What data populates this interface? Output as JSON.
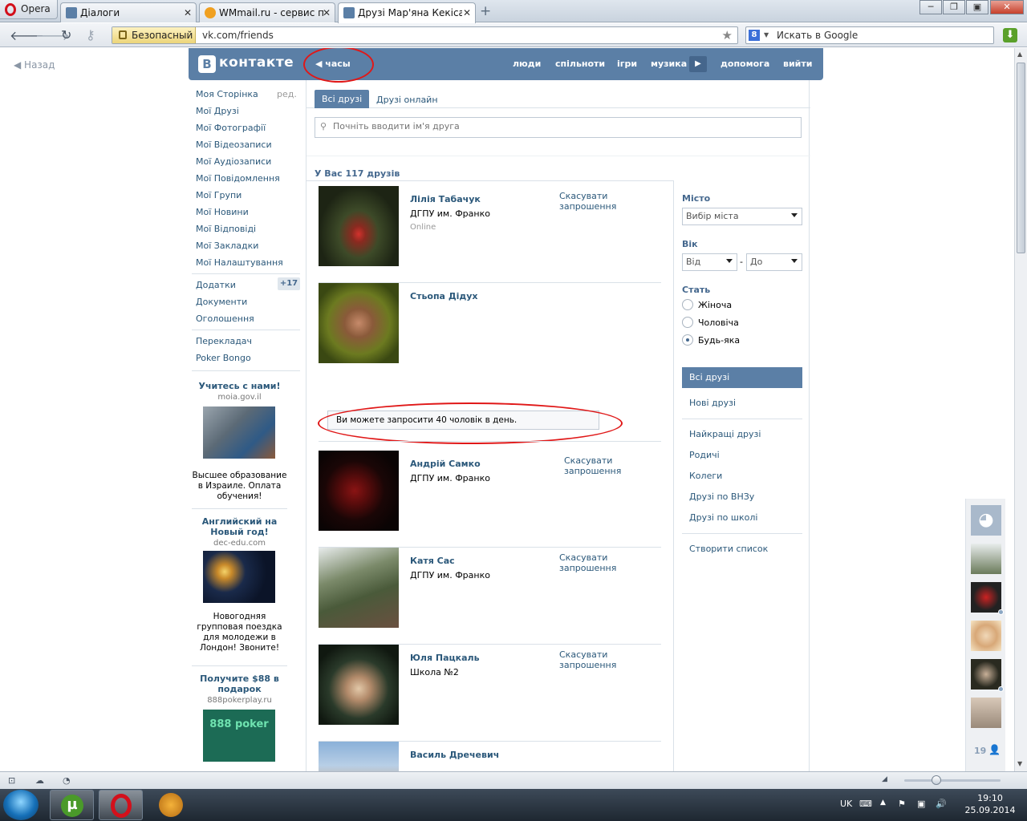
{
  "browser": {
    "opera_label": "Opera",
    "tabs": [
      {
        "title": "Діалоги",
        "active": false
      },
      {
        "title": "WMmail.ru - сервис п...",
        "active": false
      },
      {
        "title": "Друзі Мар'яна Кекіса |...",
        "active": true
      }
    ],
    "secure_label": "Безопасный",
    "url": "vk.com/friends",
    "search_placeholder": "Искать в Google",
    "search_engine_icon": "8"
  },
  "page": {
    "back_label": "Назад",
    "header": {
      "logo_letter": "В",
      "logo_text": "контакте",
      "back_link": "часы",
      "nav": [
        "люди",
        "спільноти",
        "ігри",
        "музика",
        "допомога",
        "вийти"
      ]
    },
    "left_menu": [
      {
        "label": "Моя Сторінка",
        "extra": "ред."
      },
      {
        "label": "Мої Друзі"
      },
      {
        "label": "Мої Фотографії"
      },
      {
        "label": "Мої Відеозаписи"
      },
      {
        "label": "Мої Аудіозаписи"
      },
      {
        "label": "Мої Повідомлення"
      },
      {
        "label": "Мої Групи"
      },
      {
        "label": "Мої Новини"
      },
      {
        "label": "Мої Відповіді"
      },
      {
        "label": "Мої Закладки"
      },
      {
        "label": "Мої Налаштування"
      }
    ],
    "left_menu2": [
      {
        "label": "Додатки",
        "badge": "+17"
      },
      {
        "label": "Документи"
      },
      {
        "label": "Оголошення"
      }
    ],
    "left_menu3": [
      {
        "label": "Перекладач"
      },
      {
        "label": "Poker Bongo"
      }
    ],
    "ads": [
      {
        "title": "Учитесь с нами!",
        "url": "moia.gov.il",
        "text": "Высшее образование в Израиле. Оплата обучения!"
      },
      {
        "title": "Английский на Новый год!",
        "url": "dec-edu.com",
        "text": "Новогодняя групповая поездка для молодежи в Лондон! Звоните!"
      },
      {
        "title": "Получите $88 в подарок",
        "url": "888pokerplay.ru",
        "text": "888 poker"
      }
    ],
    "tabs": [
      "Всі друзі",
      "Друзі онлайн"
    ],
    "search_placeholder": "Почніть вводити ім'я друга",
    "friends_count": "У Вас 117 друзів",
    "friends": [
      {
        "name": "Лілія Табачук",
        "uni": "ДГПУ им. Франко",
        "status": "Online",
        "action": "Скасувати запрошення"
      },
      {
        "name": "Стьопа Дідух",
        "uni": "",
        "status": "",
        "action": ""
      },
      {
        "name": "Андрій Самко",
        "uni": "ДГПУ им. Франко",
        "status": "",
        "action": "Скасувати запрошення"
      },
      {
        "name": "Катя Сас",
        "uni": "ДГПУ им. Франко",
        "status": "",
        "action": "Скасувати запрошення"
      },
      {
        "name": "Юля Пацкаль",
        "uni": "Школа №2",
        "status": "",
        "action": "Скасувати запрошення"
      },
      {
        "name": "Василь Дречевич",
        "uni": "",
        "status": "",
        "action": ""
      }
    ],
    "notice": "Ви можете запросити 40 чоловік в день.",
    "filters": {
      "city_label": "Місто",
      "city_value": "Вибір міста",
      "age_label": "Вік",
      "age_from": "Від",
      "age_dash": "-",
      "age_to": "До",
      "sex_label": "Стать",
      "sex_options": [
        "Жіноча",
        "Чоловіча",
        "Будь-яка"
      ],
      "sex_selected": "Будь-яка"
    },
    "right_menu": {
      "selected": "Всі друзі",
      "items1": [
        "Нові друзі"
      ],
      "items2": [
        "Найкращі друзі",
        "Родичі",
        "Колеги",
        "Друзі по ВНЗу",
        "Друзі по школі"
      ],
      "items3": [
        "Створити список"
      ]
    },
    "side_count": "19"
  },
  "taskbar": {
    "lang": "UK",
    "time": "19:10",
    "date": "25.09.2014"
  },
  "colors": {
    "vk_header": "#5b7fa6",
    "vk_link": "#2b587a",
    "annotation_red": "#e01818"
  }
}
